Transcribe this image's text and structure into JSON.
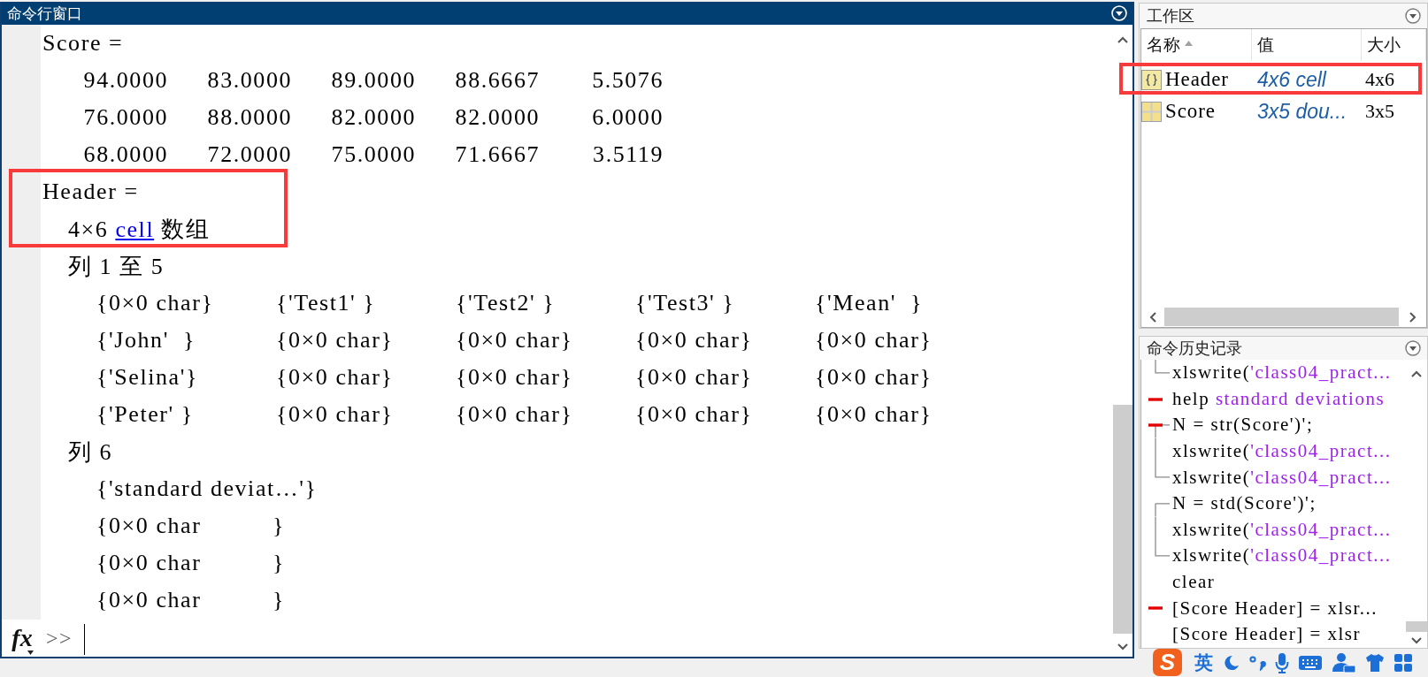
{
  "command_window": {
    "title": "命令行窗口",
    "output": [
      {
        "highlighted": false,
        "lines": [
          {
            "kind": "heading",
            "text": "Score ="
          },
          {
            "kind": "numbers",
            "cells": [
              "94.0000",
              "83.0000",
              "89.0000",
              "88.6667",
              "5.5076"
            ]
          },
          {
            "kind": "numbers",
            "cells": [
              "76.0000",
              "88.0000",
              "82.0000",
              "82.0000",
              "6.0000"
            ]
          },
          {
            "kind": "numbers",
            "cells": [
              "68.0000",
              "72.0000",
              "75.0000",
              "71.6667",
              "3.5119"
            ]
          }
        ]
      },
      {
        "highlighted": true,
        "lines": [
          {
            "kind": "heading",
            "text": "Header ="
          },
          {
            "kind": "size",
            "before": "4×6",
            "link": "cell",
            "after": "数组"
          }
        ]
      },
      {
        "highlighted": false,
        "lines": [
          {
            "kind": "label",
            "text": "列 1 至 5"
          },
          {
            "kind": "cells",
            "cells": [
              "{0×0 char}",
              "{'Test1' }",
              "{'Test2' }",
              "{'Test3' }",
              "{'Mean'  }"
            ]
          },
          {
            "kind": "cells",
            "cells": [
              "{'John'  }",
              "{0×0 char}",
              "{0×0 char}",
              "{0×0 char}",
              "{0×0 char}"
            ]
          },
          {
            "kind": "cells",
            "cells": [
              "{'Selina'}",
              "{0×0 char}",
              "{0×0 char}",
              "{0×0 char}",
              "{0×0 char}"
            ]
          },
          {
            "kind": "cells",
            "cells": [
              "{'Peter' }",
              "{0×0 char}",
              "{0×0 char}",
              "{0×0 char}",
              "{0×0 char}"
            ]
          },
          {
            "kind": "label",
            "text": "列 6"
          },
          {
            "kind": "cells",
            "cells": [
              "{'standard deviat…'}"
            ]
          },
          {
            "kind": "cells",
            "cells": [
              "{0×0 char          }"
            ]
          },
          {
            "kind": "cells",
            "cells": [
              "{0×0 char          }"
            ]
          },
          {
            "kind": "cells",
            "cells": [
              "{0×0 char          }"
            ]
          }
        ]
      }
    ],
    "function_button": "fx",
    "prompt": ">>"
  },
  "workspace": {
    "title": "工作区",
    "columns": [
      {
        "label": "名称",
        "sorted": true
      },
      {
        "label": "值",
        "sorted": false
      },
      {
        "label": "大小",
        "sorted": false
      }
    ],
    "rows": [
      {
        "kind": "cell",
        "name": "Header",
        "value": "4x6 cell",
        "size": "4x6",
        "highlighted": true
      },
      {
        "kind": "matrix",
        "name": "Score",
        "value": "3x5 dou...",
        "size": "3x5",
        "highlighted": false
      }
    ]
  },
  "command_history": {
    "title": "命令历史记录",
    "entries": [
      {
        "kind": "last",
        "parts": [
          {
            "kind": "code",
            "text": "xlswrite("
          },
          {
            "kind": "string",
            "text": "'class04_pract..."
          }
        ],
        "error": false
      },
      {
        "kind": "single",
        "parts": [
          {
            "kind": "code",
            "text": "help "
          },
          {
            "kind": "string",
            "text": "standard deviations"
          }
        ],
        "error": true
      },
      {
        "kind": "first",
        "parts": [
          {
            "kind": "code",
            "text": "N = str(Score')';"
          }
        ],
        "error": true
      },
      {
        "kind": "middle",
        "parts": [
          {
            "kind": "code",
            "text": "xlswrite("
          },
          {
            "kind": "string",
            "text": "'class04_pract..."
          }
        ],
        "error": false
      },
      {
        "kind": "last",
        "parts": [
          {
            "kind": "code",
            "text": "xlswrite("
          },
          {
            "kind": "string",
            "text": "'class04_pract..."
          }
        ],
        "error": false
      },
      {
        "kind": "first",
        "parts": [
          {
            "kind": "code",
            "text": "N = std(Score')';"
          }
        ],
        "error": false
      },
      {
        "kind": "middle",
        "parts": [
          {
            "kind": "code",
            "text": "xlswrite("
          },
          {
            "kind": "string",
            "text": "'class04_pract..."
          }
        ],
        "error": false
      },
      {
        "kind": "last",
        "parts": [
          {
            "kind": "code",
            "text": "xlswrite("
          },
          {
            "kind": "string",
            "text": "'class04_pract..."
          }
        ],
        "error": false
      },
      {
        "kind": "single",
        "parts": [
          {
            "kind": "code",
            "text": "clear"
          }
        ],
        "error": false
      },
      {
        "kind": "single",
        "parts": [
          {
            "kind": "code",
            "text": "[Score Header] = xlsr..."
          }
        ],
        "error": true
      },
      {
        "kind": "single",
        "parts": [
          {
            "kind": "code",
            "text": "[Score Header] = xlsr"
          }
        ],
        "error": false
      }
    ]
  },
  "ime_toolbar": {
    "logo": "S",
    "mode": "英"
  }
}
